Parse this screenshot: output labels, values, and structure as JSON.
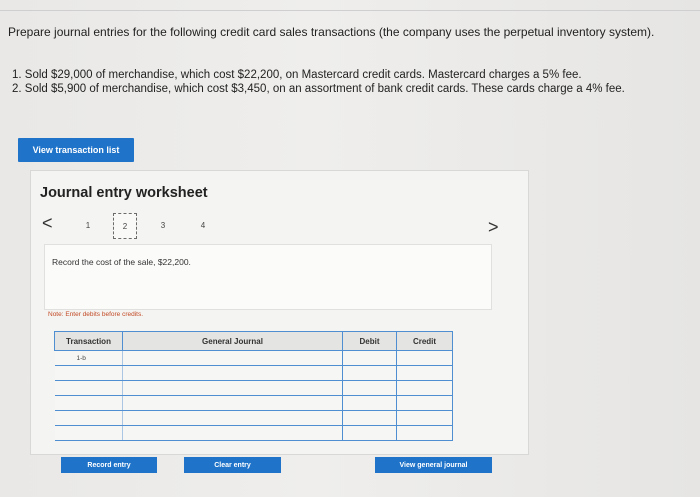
{
  "problem": {
    "prompt": "Prepare journal entries for the following credit card sales transactions (the company uses the perpetual inventory system).",
    "items": [
      "1. Sold $29,000 of merchandise, which cost $22,200, on Mastercard credit cards. Mastercard charges a 5% fee.",
      "2. Sold $5,900 of merchandise, which cost $3,450, on an assortment of bank credit cards. These cards charge a 4% fee."
    ]
  },
  "view_transactions_label": "View transaction list",
  "worksheet": {
    "title": "Journal entry worksheet",
    "nav": {
      "prev": "<",
      "next": ">",
      "steps": [
        "1",
        "2",
        "3",
        "4"
      ],
      "active_step": "2"
    },
    "instruction": "Record the cost of the sale, $22,200.",
    "note": "Note: Enter debits before credits.",
    "table": {
      "headers": {
        "transaction": "Transaction",
        "general_journal": "General Journal",
        "debit": "Debit",
        "credit": "Credit"
      },
      "rows": [
        {
          "transaction": "1-b",
          "account": "",
          "debit": "",
          "credit": ""
        },
        {
          "transaction": "",
          "account": "",
          "debit": "",
          "credit": ""
        },
        {
          "transaction": "",
          "account": "",
          "debit": "",
          "credit": ""
        },
        {
          "transaction": "",
          "account": "",
          "debit": "",
          "credit": ""
        },
        {
          "transaction": "",
          "account": "",
          "debit": "",
          "credit": ""
        },
        {
          "transaction": "",
          "account": "",
          "debit": "",
          "credit": ""
        }
      ]
    },
    "buttons": {
      "record": "Record entry",
      "clear": "Clear entry",
      "view_general_journal": "View general journal"
    }
  }
}
